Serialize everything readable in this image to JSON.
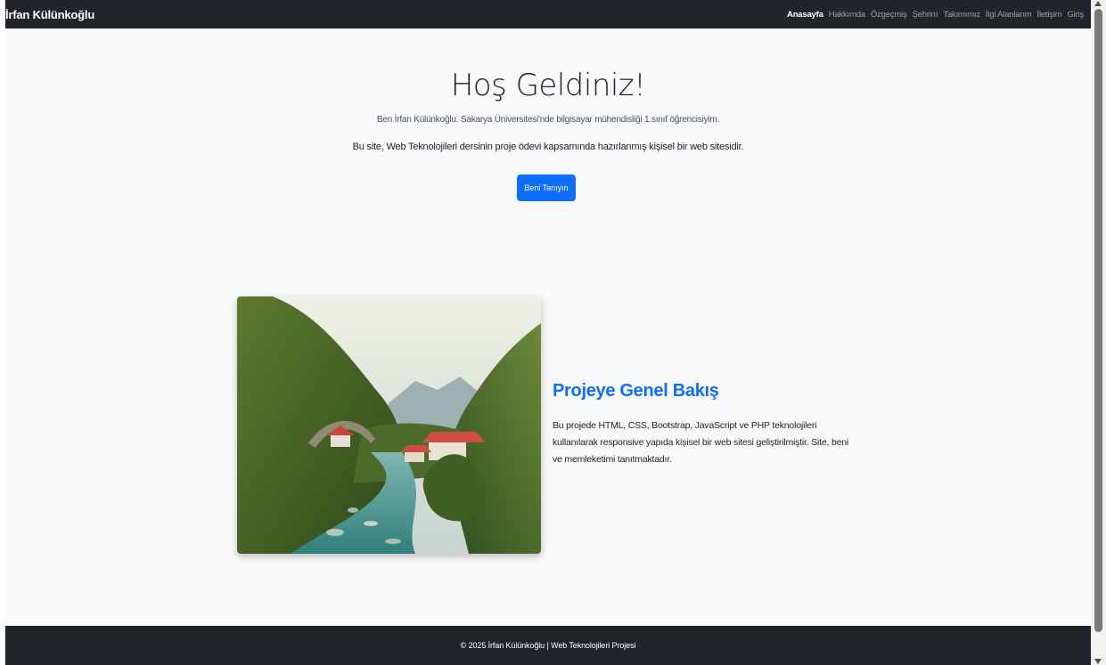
{
  "navbar": {
    "brand": "İrfan Külünkoğlu",
    "links": [
      {
        "label": "Anasayfa",
        "active": true
      },
      {
        "label": "Hakkımda"
      },
      {
        "label": "Özgeçmiş"
      },
      {
        "label": "Şehrim"
      },
      {
        "label": "Takımımız"
      },
      {
        "label": "İlgi Alanlarım"
      },
      {
        "label": "İletişim"
      },
      {
        "label": "Giriş"
      }
    ]
  },
  "hero": {
    "title": "Hoş Geldiniz!",
    "intro": "Ben İrfan Külünkoğlu. Sakarya Üniversitesi'nde bilgisayar mühendisliği 1.sınıf öğrencisiyim.",
    "description": "Bu site, Web Teknolojileri dersinin proje ödevi kapsamında hazırlanmış kişisel bir web sitesidir.",
    "button_label": "Beni Tanıyın"
  },
  "overview": {
    "title": "Projeye Genel Bakış",
    "text": "Bu projede HTML, CSS, Bootstrap, JavaScript ve PHP teknolojileri kullanılarak responsive yapıda kişisel bir web sitesi geliştirilmiştir. Site, beni ve memleketimi tanıtmaktadır."
  },
  "footer": {
    "text": "© 2025 İrfan Külünkoğlu | Web Teknolojileri Projesi"
  },
  "colors": {
    "navbar_bg": "#212529",
    "primary": "#0d6efd",
    "page_bg": "#f8f9fa"
  }
}
